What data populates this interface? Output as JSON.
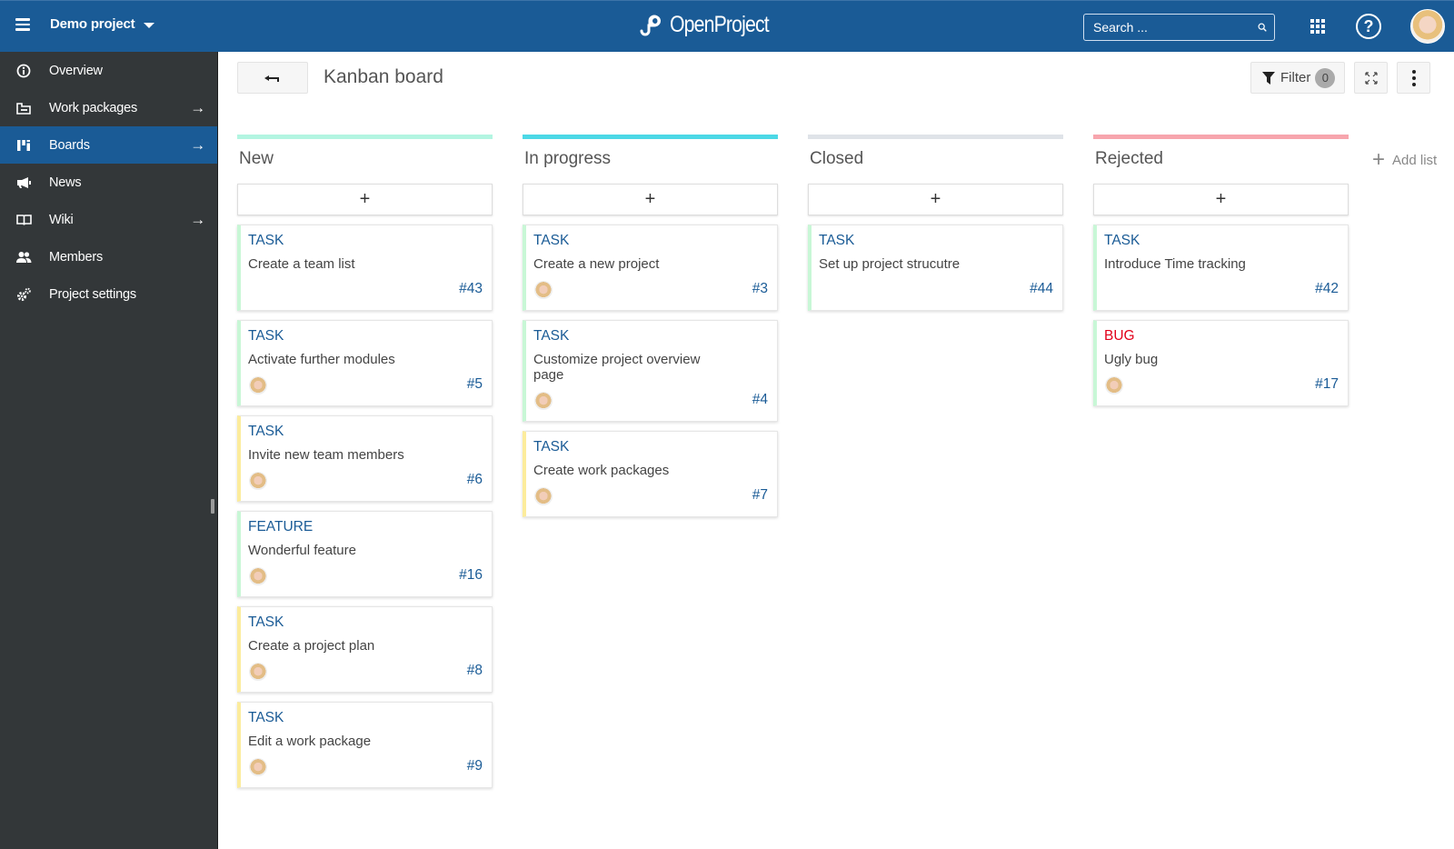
{
  "header": {
    "project_name": "Demo project",
    "logo_text": "OpenProject",
    "search_placeholder": "Search ...",
    "help_label": "?"
  },
  "sidebar": {
    "items": [
      {
        "label": "Overview",
        "icon": "info-icon",
        "arrow": false,
        "active": false
      },
      {
        "label": "Work packages",
        "icon": "work-packages-icon",
        "arrow": true,
        "active": false
      },
      {
        "label": "Boards",
        "icon": "boards-icon",
        "arrow": true,
        "active": true
      },
      {
        "label": "News",
        "icon": "megaphone-icon",
        "arrow": false,
        "active": false
      },
      {
        "label": "Wiki",
        "icon": "book-icon",
        "arrow": true,
        "active": false
      },
      {
        "label": "Members",
        "icon": "members-icon",
        "arrow": false,
        "active": false
      },
      {
        "label": "Project settings",
        "icon": "gears-icon",
        "arrow": false,
        "active": false
      }
    ],
    "arrow_glyph": "→"
  },
  "toolbar": {
    "title": "Kanban board",
    "filter_label": "Filter",
    "filter_count": "0"
  },
  "board": {
    "add_card_label": "+",
    "add_list_label": "Add list",
    "columns": [
      {
        "title": "New",
        "color": "#b3f5e1",
        "cards": [
          {
            "type": "TASK",
            "subject": "Create a team list",
            "id": "#43",
            "assignee": false,
            "status_color": "#c8f7d6"
          },
          {
            "type": "TASK",
            "subject": "Activate further modules",
            "id": "#5",
            "assignee": true,
            "status_color": "#c8f7d6"
          },
          {
            "type": "TASK",
            "subject": "Invite new team members",
            "id": "#6",
            "assignee": true,
            "status_color": "#fcec9c"
          },
          {
            "type": "FEATURE",
            "subject": "Wonderful feature",
            "id": "#16",
            "assignee": true,
            "status_color": "#c8f7d6"
          },
          {
            "type": "TASK",
            "subject": "Create a project plan",
            "id": "#8",
            "assignee": true,
            "status_color": "#fcec9c"
          },
          {
            "type": "TASK",
            "subject": "Edit a work package",
            "id": "#9",
            "assignee": true,
            "status_color": "#fcec9c"
          }
        ]
      },
      {
        "title": "In progress",
        "color": "#4cd8e6",
        "cards": [
          {
            "type": "TASK",
            "subject": "Create a new project",
            "id": "#3",
            "assignee": true,
            "status_color": "#c8f7d6"
          },
          {
            "type": "TASK",
            "subject": "Customize project overview page",
            "id": "#4",
            "assignee": true,
            "status_color": "#c8f7d6"
          },
          {
            "type": "TASK",
            "subject": "Create work packages",
            "id": "#7",
            "assignee": true,
            "status_color": "#fcec9c"
          }
        ]
      },
      {
        "title": "Closed",
        "color": "#dfe3e8",
        "cards": [
          {
            "type": "TASK",
            "subject": "Set up project strucutre",
            "id": "#44",
            "assignee": false,
            "status_color": "#c8f7d6"
          }
        ]
      },
      {
        "title": "Rejected",
        "color": "#f7a5ad",
        "cards": [
          {
            "type": "TASK",
            "subject": "Introduce Time tracking",
            "id": "#42",
            "assignee": false,
            "status_color": "#c8f7d6"
          },
          {
            "type": "BUG",
            "subject": "Ugly bug",
            "id": "#17",
            "assignee": true,
            "status_color": "#c8f7d6"
          }
        ]
      }
    ]
  },
  "colors": {
    "brand": "#1a5b96",
    "sidebar_bg": "#333739",
    "type_task": "#1a5b96",
    "type_bug": "#e2001a"
  }
}
